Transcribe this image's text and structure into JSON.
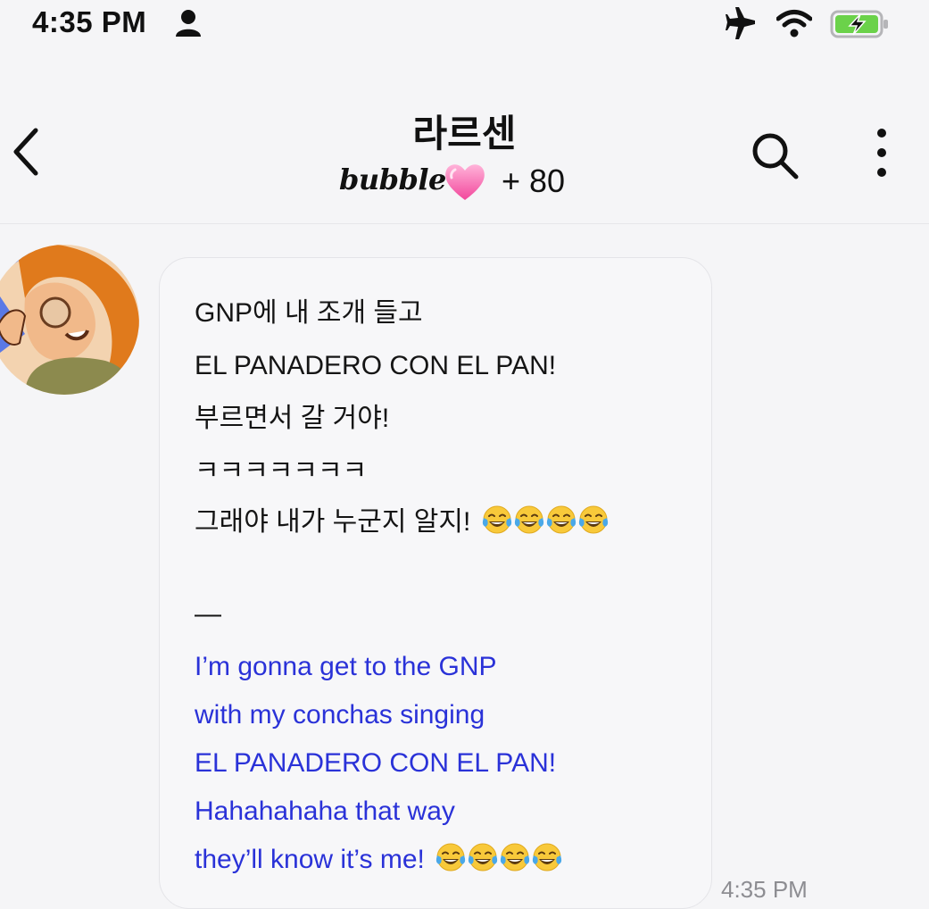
{
  "status_bar": {
    "time": "4:35 PM",
    "icons": [
      "person-icon",
      "airplane-icon",
      "wifi-icon",
      "battery-charging-icon"
    ]
  },
  "header": {
    "title": "라르센",
    "app_logo_text": "bubble",
    "heart_icon": "pink-heart-icon",
    "member_count": "+ 80",
    "back_icon": "chevron-left-icon",
    "search_icon": "search-icon",
    "more_icon": "more-vertical-icon"
  },
  "message": {
    "korean_lines": [
      "GNP에 내 조개 들고",
      "EL PANADERO CON EL PAN!",
      "부르면서 갈 거야!",
      "ㅋㅋㅋㅋㅋㅋㅋ",
      "그래야 내가 누군지 알지!"
    ],
    "separator": "—",
    "english_lines": [
      "I’m gonna get to the GNP",
      "with my conchas singing",
      "EL PANADERO CON EL PAN!",
      "Hahahahaha that way",
      "they’ll know it’s me!"
    ],
    "emoji": "face-with-tears-of-joy",
    "korean_emoji_count": 4,
    "english_emoji_count": 4,
    "time": "4:35 PM"
  },
  "colors": {
    "background": "#f5f5f7",
    "translation_text": "#2a32d8",
    "heart": "#ff6fb3",
    "battery_fill": "#6bd24a"
  }
}
